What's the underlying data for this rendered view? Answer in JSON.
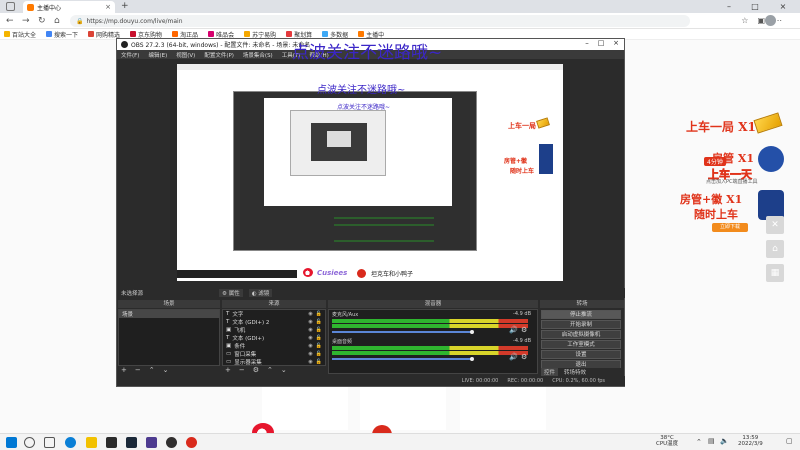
{
  "browser": {
    "tab_title": "主播中心",
    "new_tab": "+",
    "url": "https://mp.douyu.com/live/main",
    "bookmarks": [
      "百站大全",
      "搜索一下",
      "网购精选",
      "京东购物",
      "淘正品",
      "唯品会",
      "苏宁易购",
      "聚划算",
      "多数据",
      "主播中"
    ]
  },
  "obs": {
    "title": "OBS 27.2.3 (64-bit, windows) - 配置文件: 未命名 - 场景: 未命名",
    "menu": [
      "文件(F)",
      "编辑(E)",
      "视图(V)",
      "配置文件(P)",
      "场景集合(S)",
      "工具(T)",
      "帮助(H)"
    ],
    "no_source": "未选择源",
    "props_button": "属性",
    "filters_button": "滤镜",
    "panels": {
      "scenes": "场景",
      "sources": "来源",
      "mixer": "混音器",
      "transitions": "转场"
    },
    "scene_items": [
      "场景"
    ],
    "sources": [
      "文字",
      "文本 (GDI+) 2",
      "飞机",
      "文本 (GDI+)",
      "条件",
      "窗口采集",
      "显示器采集"
    ],
    "mixer": [
      {
        "name": "麦克风/Aux",
        "level": "-4.9 dB"
      },
      {
        "name": "桌面音频",
        "level": "-4.9 dB"
      }
    ],
    "controls": [
      "停止推流",
      "开始录制",
      "启动虚拟摄像机",
      "工作室模式",
      "设置",
      "退出"
    ],
    "bottom_tabs": [
      "控件",
      "转场特效"
    ],
    "status": {
      "live": "LIVE: 00:00:00",
      "rec": "REC: 00:00:00",
      "cpu": "CPU: 0.2%, 60.00 fps"
    }
  },
  "overlay": {
    "banner": "点波关注不迷路哦~",
    "weibo_name": "Cusiees",
    "channel": "坦克车和小鸭子"
  },
  "promo": {
    "line1": "上车一局",
    "x1": "X1",
    "line2": "房管",
    "line3": "上车一天",
    "line4": "房管+徽",
    "line5": "随时上车",
    "sub": "点击加入PC端直播工具",
    "badge": "4分钟",
    "btn": "立即下载"
  },
  "taskbar": {
    "weather": "38°C",
    "weather_sub": "CPU温度",
    "time": "13:59",
    "date": "2022/3/9"
  }
}
